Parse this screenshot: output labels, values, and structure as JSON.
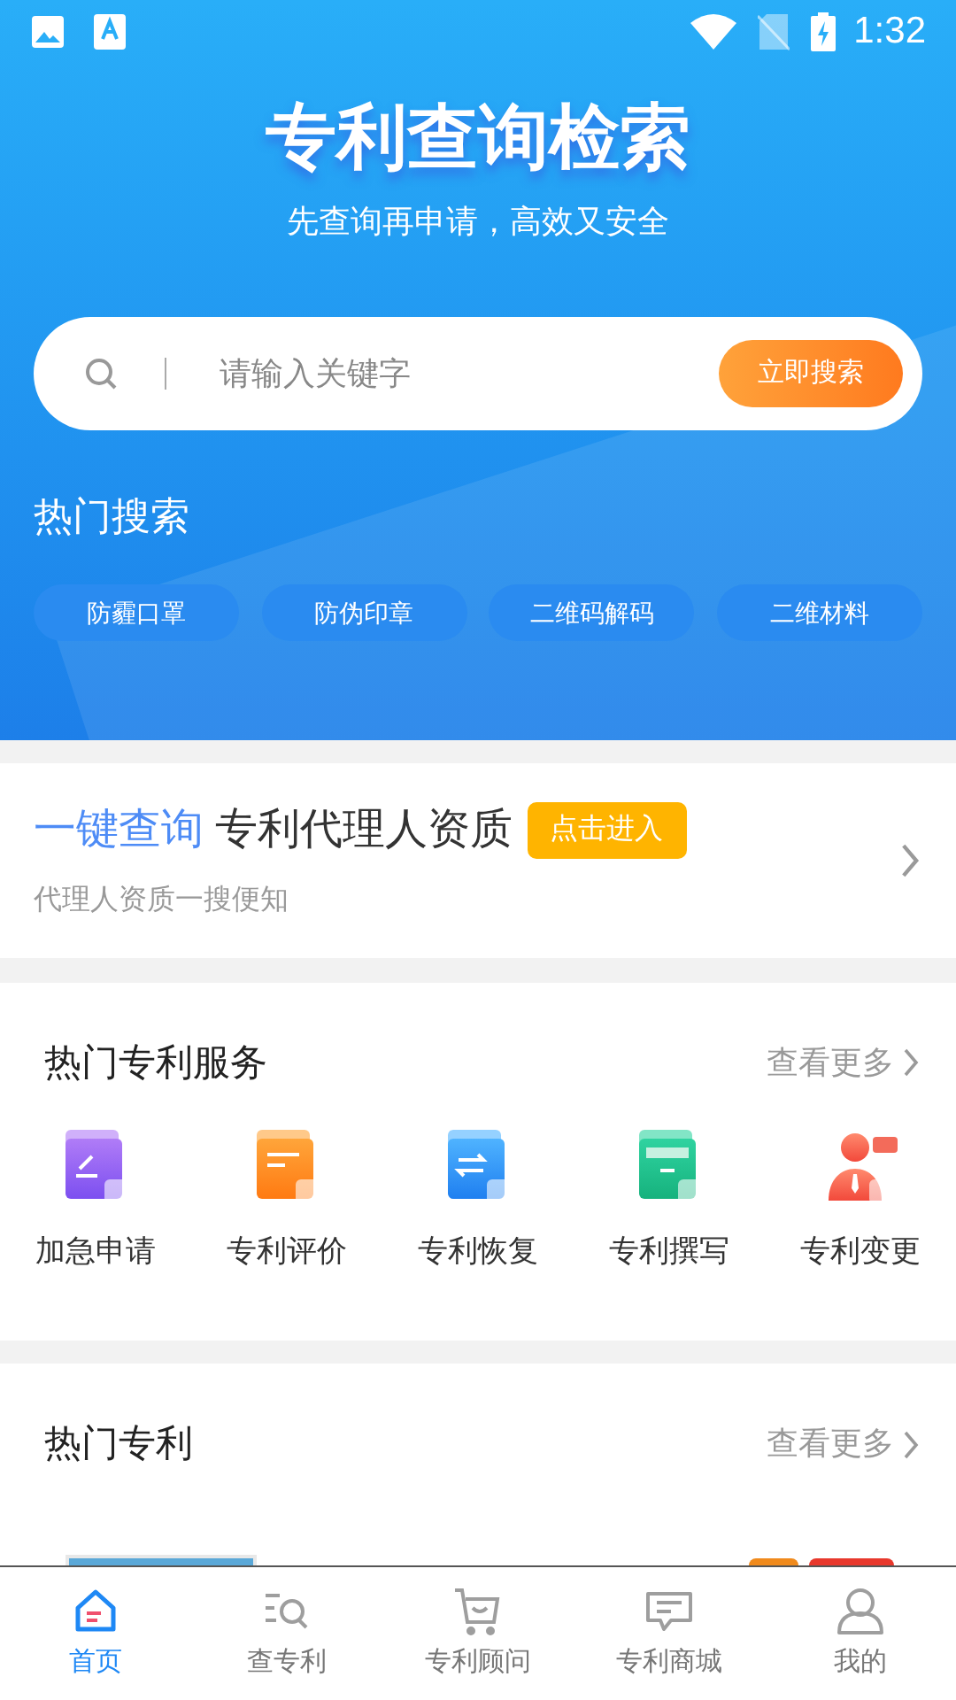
{
  "status_bar": {
    "time": "1:32"
  },
  "header": {
    "title": "专利查询检索",
    "subtitle": "先查询再申请，高效又安全"
  },
  "search": {
    "placeholder": "请输入关键字",
    "button": "立即搜索"
  },
  "hot_search": {
    "title": "热门搜索",
    "tags": [
      "防霾口罩",
      "防伪印章",
      "二维码解码",
      "二维材料"
    ]
  },
  "agent_banner": {
    "highlight": "一键查询",
    "title": "专利代理人资质",
    "button": "点击进入",
    "subtitle": "代理人资质一搜便知"
  },
  "services": {
    "title": "热门专利服务",
    "more": "查看更多",
    "items": [
      {
        "label": "加急申请",
        "kind": "urgent"
      },
      {
        "label": "专利评价",
        "kind": "evaluate"
      },
      {
        "label": "专利恢复",
        "kind": "restore"
      },
      {
        "label": "专利撰写",
        "kind": "write"
      },
      {
        "label": "专利变更",
        "kind": "change"
      }
    ]
  },
  "hot_patents": {
    "title": "热门专利",
    "more": "查看更多"
  },
  "tab_bar": [
    {
      "label": "首页",
      "kind": "home",
      "selected": true
    },
    {
      "label": "查专利",
      "kind": "search",
      "selected": false
    },
    {
      "label": "专利顾问",
      "kind": "cart",
      "selected": false
    },
    {
      "label": "专利商城",
      "kind": "chat",
      "selected": false
    },
    {
      "label": "我的",
      "kind": "user",
      "selected": false
    }
  ]
}
